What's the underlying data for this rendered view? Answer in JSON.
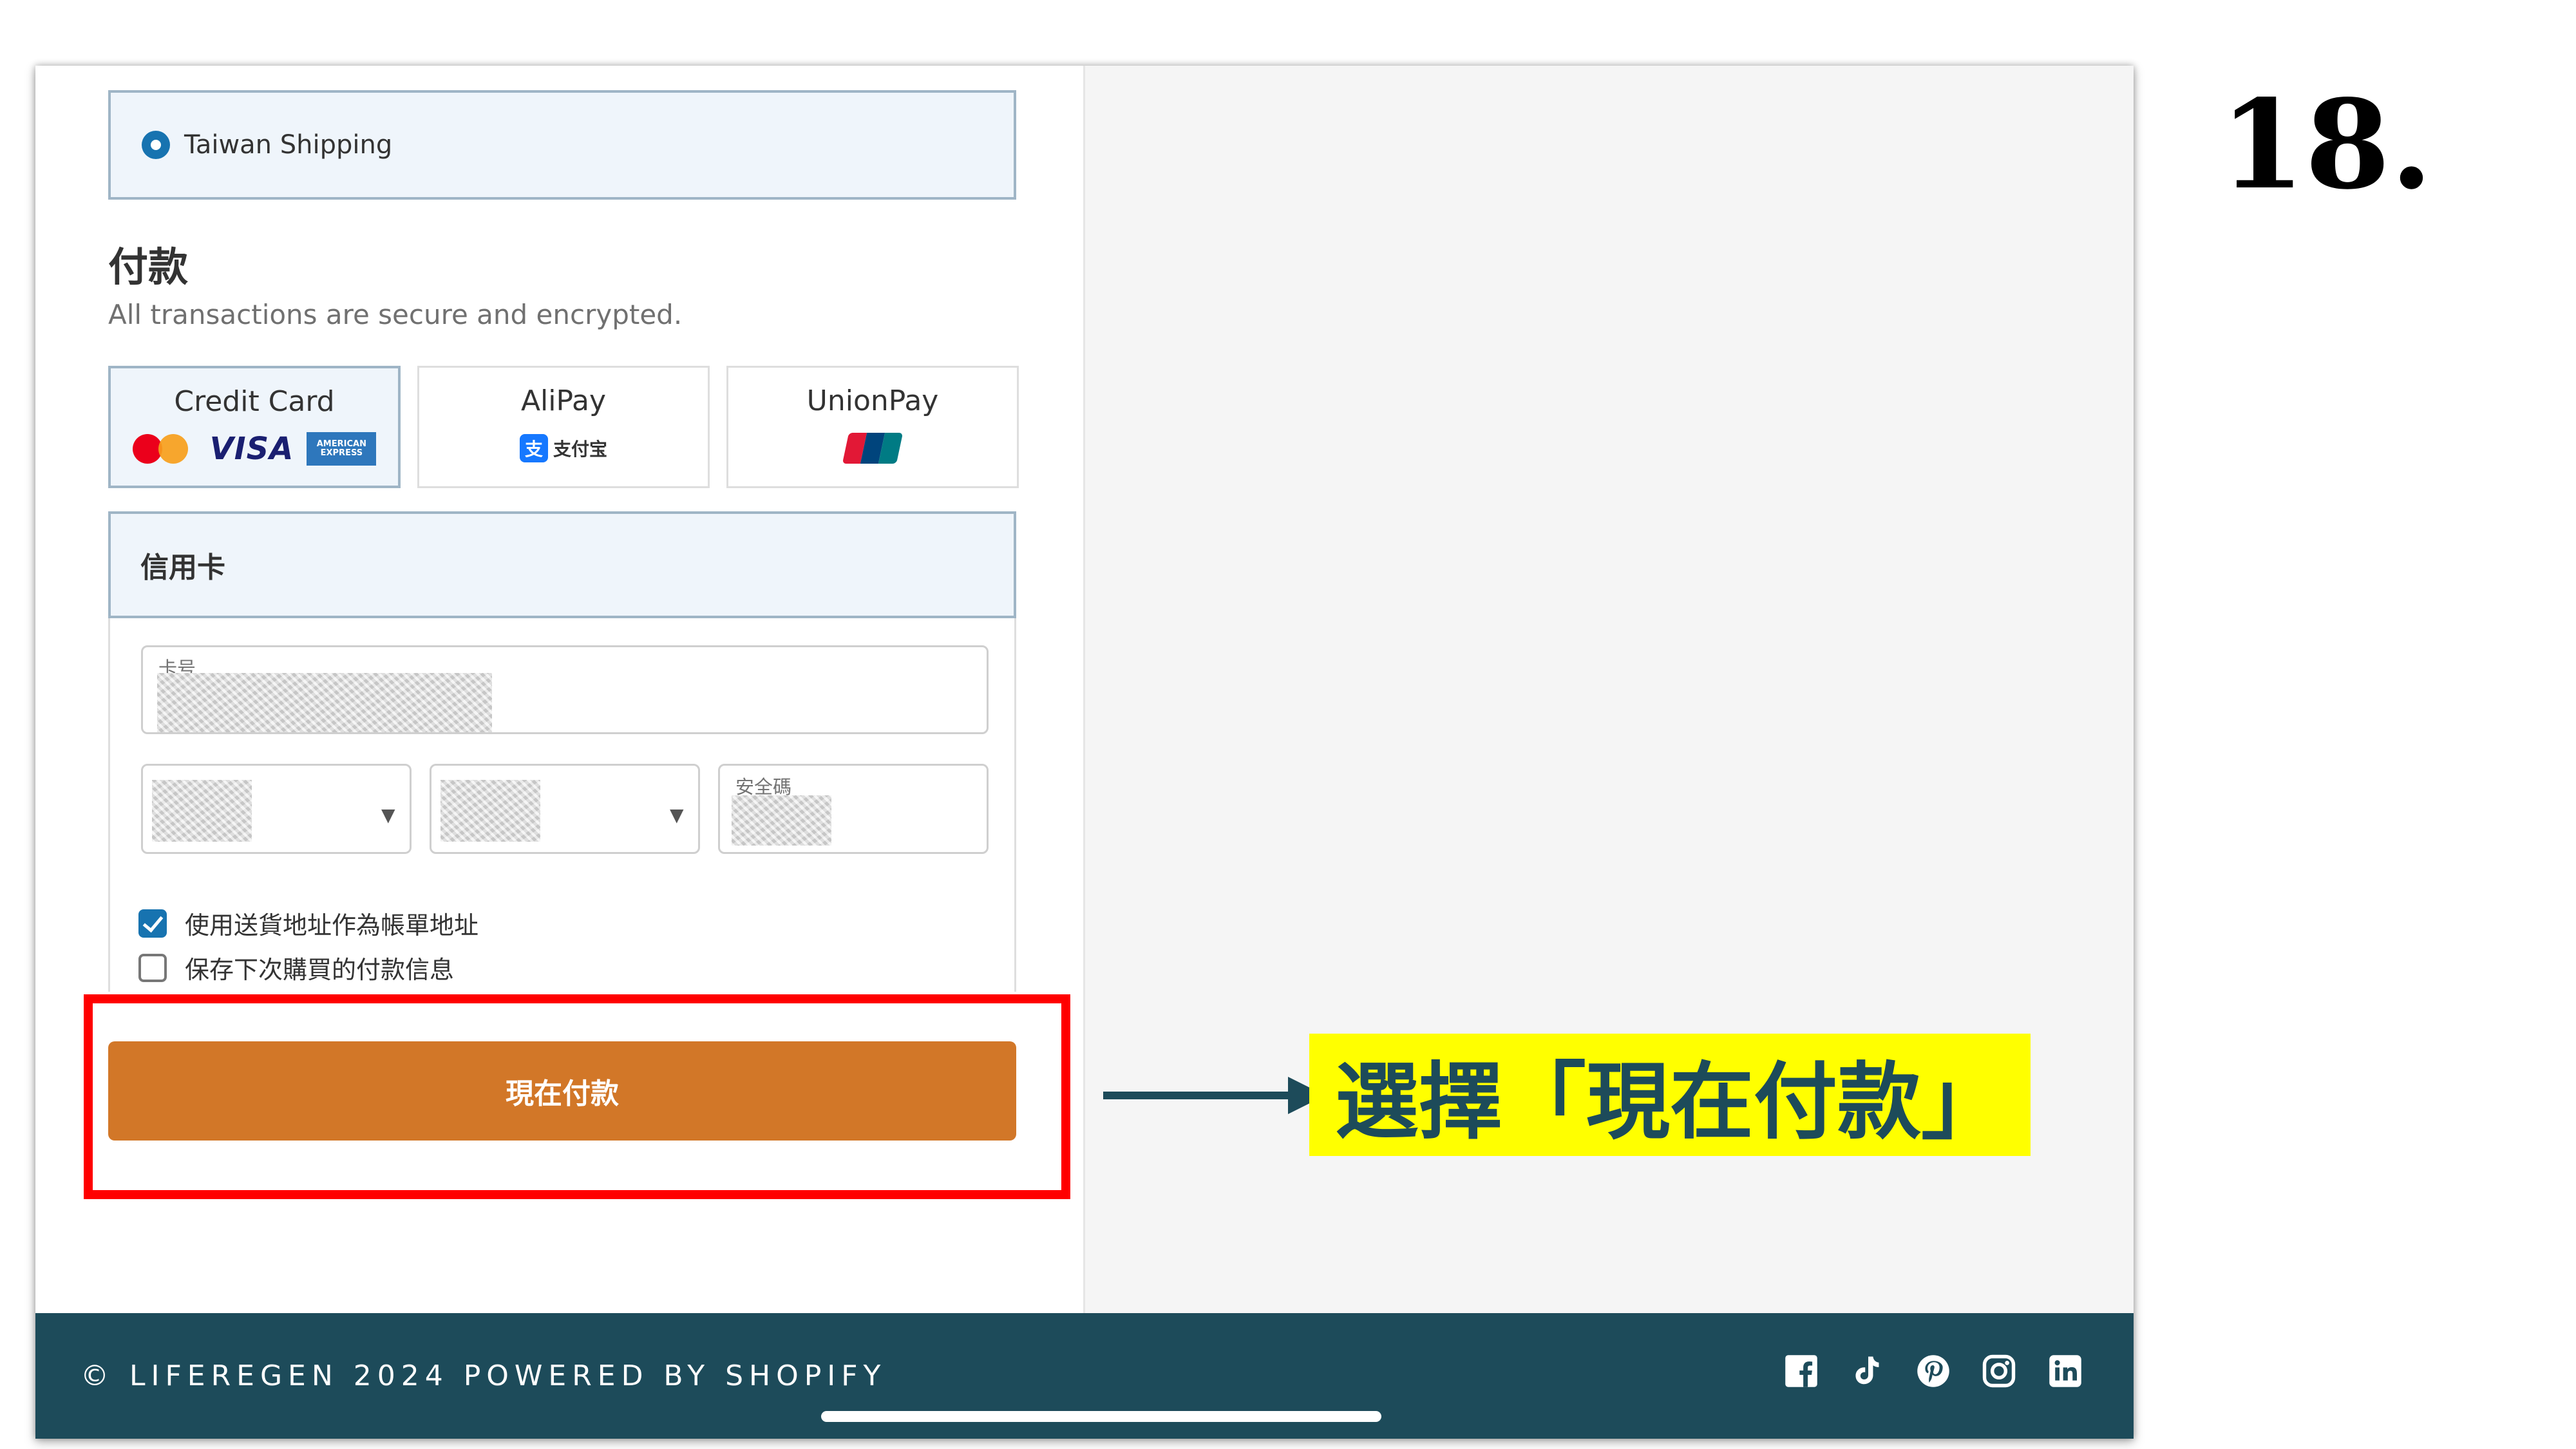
{
  "shipping": {
    "option_label": "Taiwan Shipping"
  },
  "payment": {
    "title": "付款",
    "subtitle": "All transactions are secure and encrypted.",
    "methods": [
      {
        "label": "Credit Card",
        "logos": [
          "mastercard-icon",
          "visa-icon",
          "amex-icon"
        ],
        "selected": true
      },
      {
        "label": "AliPay",
        "logos": [
          "alipay-icon"
        ],
        "selected": false
      },
      {
        "label": "UnionPay",
        "logos": [
          "unionpay-icon"
        ],
        "selected": false
      }
    ],
    "logo_text": {
      "visa": "VISA",
      "amex": "AMERICAN EXPRESS",
      "alipay_mark": "支",
      "alipay_word": "支付宝"
    },
    "credit_card_header": "信用卡",
    "card_number_label": "卡号",
    "security_code_label": "安全碼",
    "use_shipping_address_label": "使用送貨地址作為帳單地址",
    "use_shipping_address_checked": true,
    "save_payment_label": "保存下次購買的付款信息",
    "save_payment_checked": false,
    "pay_now_button": "現在付款"
  },
  "footer": {
    "copyright": "© LIFEREGEN 2024 POWERED BY SHOPIFY",
    "social_icons": [
      "facebook-icon",
      "tiktok-icon",
      "pinterest-icon",
      "instagram-icon",
      "linkedin-icon"
    ]
  },
  "annotation": {
    "callout_text": "選擇「現在付款」",
    "step_number": "18.",
    "highlight_color": "#ff0000",
    "callout_background": "#ffff00"
  },
  "colors": {
    "accent_blue": "#1773b0",
    "pay_button": "#d27728",
    "footer_background": "#1d4b5a",
    "selected_border": "#9fb5c6"
  }
}
